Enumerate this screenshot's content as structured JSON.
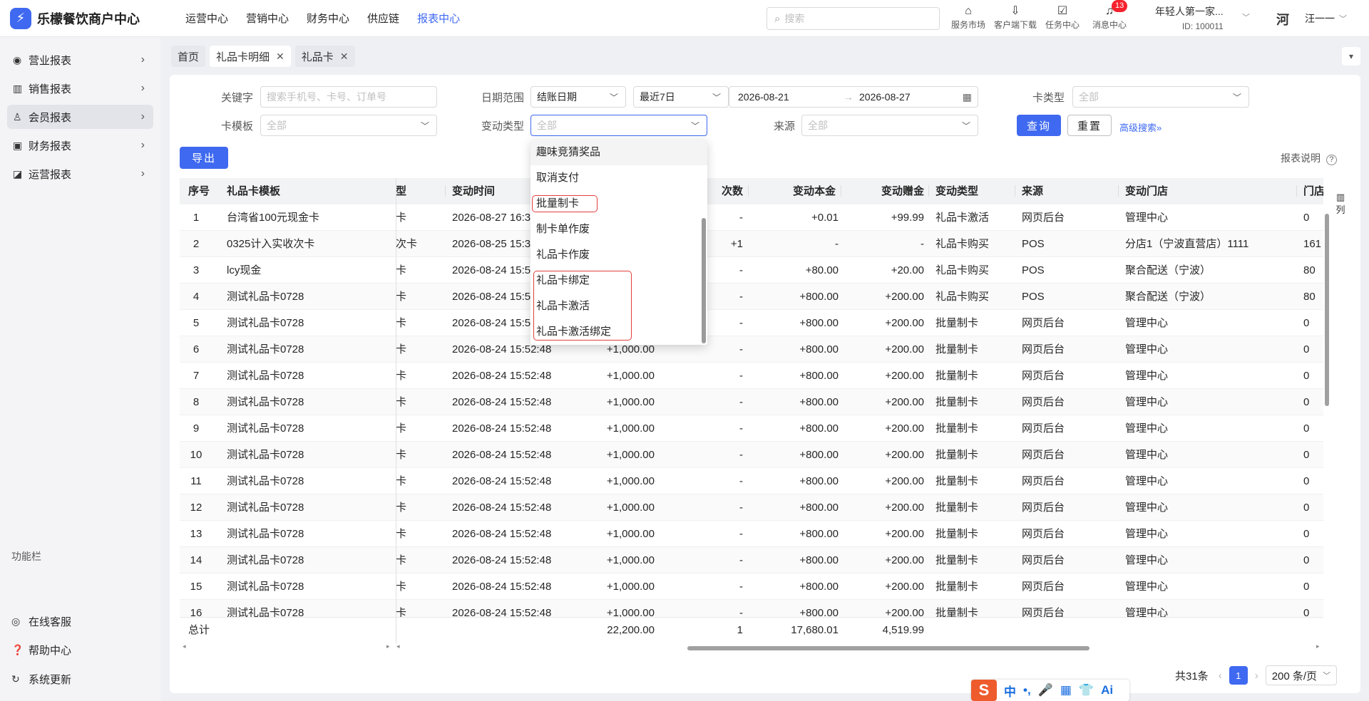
{
  "app": {
    "logo_glyph": "⚡",
    "title": "乐檬餐饮商户中心"
  },
  "topnav": [
    "运营中心",
    "营销中心",
    "财务中心",
    "供应链",
    "报表中心"
  ],
  "search": {
    "placeholder": "搜索"
  },
  "tools": [
    {
      "label": "服务市场",
      "icon": "shop-icon"
    },
    {
      "label": "客户端下载",
      "icon": "download-icon"
    },
    {
      "label": "任务中心",
      "icon": "task-icon"
    },
    {
      "label": "消息中心",
      "icon": "bell-icon",
      "badge": "13"
    }
  ],
  "shop": {
    "name": "年轻人第一家...",
    "id": "ID: 100011"
  },
  "user": {
    "avatar": "河",
    "name": "汪一一"
  },
  "sidebar": {
    "items": [
      {
        "label": "营业报表",
        "icon": "globe-icon"
      },
      {
        "label": "销售报表",
        "icon": "bank-icon"
      },
      {
        "label": "会员报表",
        "icon": "user-icon"
      },
      {
        "label": "财务报表",
        "icon": "finance-icon"
      },
      {
        "label": "运营报表",
        "icon": "bag-icon"
      }
    ],
    "function_title": "功能栏",
    "functions": [
      {
        "label": "在线客服",
        "icon": "service-icon"
      },
      {
        "label": "帮助中心",
        "icon": "help-icon"
      },
      {
        "label": "系统更新",
        "icon": "refresh-icon"
      }
    ]
  },
  "tabs": [
    {
      "label": "首页",
      "closable": false
    },
    {
      "label": "礼品卡明细",
      "closable": true
    },
    {
      "label": "礼品卡",
      "closable": true
    }
  ],
  "filters": {
    "keyword_label": "关键字",
    "keyword_placeholder": "搜索手机号、卡号、订单号",
    "date_label": "日期范围",
    "date_type": "结账日期",
    "date_preset": "最近7日",
    "date_start": "2026-08-21",
    "date_sep": "→",
    "date_end": "2026-08-27",
    "card_type_label": "卡类型",
    "card_type_value": "全部",
    "template_label": "卡模板",
    "template_value": "全部",
    "change_type_label": "变动类型",
    "change_type_value": "全部",
    "source_label": "来源",
    "source_value": "全部",
    "query_btn": "查询",
    "reset_btn": "重置",
    "advanced": "高级搜索»"
  },
  "export_btn": "导出",
  "report_explain": "报表说明",
  "column_settings": "列",
  "dropdown": {
    "options": [
      "趣味竞猜奖品",
      "取消支付",
      "批量制卡",
      "制卡单作废",
      "礼品卡作废",
      "礼品卡绑定",
      "礼品卡激活",
      "礼品卡激活绑定"
    ]
  },
  "table": {
    "columns": [
      "序号",
      "礼品卡模板",
      "型",
      "变动时间",
      "次数",
      "变动本金",
      "变动赠金",
      "变动类型",
      "来源",
      "变动门店",
      "门店编"
    ],
    "rows": [
      [
        "1",
        "台湾省100元现金卡",
        "卡",
        "2026-08-27 16:3",
        "",
        "-",
        "+0.01",
        "+99.99",
        "礼品卡激活",
        "网页后台",
        "管理中心",
        "0"
      ],
      [
        "2",
        "0325计入实收次卡",
        "次卡",
        "2026-08-25 15:3",
        "",
        "+1",
        "-",
        "-",
        "礼品卡购买",
        "POS",
        "分店1（宁波直营店）1111",
        "161"
      ],
      [
        "3",
        "lcy现金",
        "卡",
        "2026-08-24 15:5",
        "",
        "-",
        "+80.00",
        "+20.00",
        "礼品卡购买",
        "POS",
        "聚合配送（宁波）",
        "80"
      ],
      [
        "4",
        "测试礼品卡0728",
        "卡",
        "2026-08-24 15:5",
        "",
        "-",
        "+800.00",
        "+200.00",
        "礼品卡购买",
        "POS",
        "聚合配送（宁波）",
        "80"
      ],
      [
        "5",
        "测试礼品卡0728",
        "卡",
        "2026-08-24 15:5",
        "",
        "-",
        "+800.00",
        "+200.00",
        "批量制卡",
        "网页后台",
        "管理中心",
        "0"
      ],
      [
        "6",
        "测试礼品卡0728",
        "卡",
        "2026-08-24 15:52:48",
        "+1,000.00",
        "-",
        "+800.00",
        "+200.00",
        "批量制卡",
        "网页后台",
        "管理中心",
        "0"
      ],
      [
        "7",
        "测试礼品卡0728",
        "卡",
        "2026-08-24 15:52:48",
        "+1,000.00",
        "-",
        "+800.00",
        "+200.00",
        "批量制卡",
        "网页后台",
        "管理中心",
        "0"
      ],
      [
        "8",
        "测试礼品卡0728",
        "卡",
        "2026-08-24 15:52:48",
        "+1,000.00",
        "-",
        "+800.00",
        "+200.00",
        "批量制卡",
        "网页后台",
        "管理中心",
        "0"
      ],
      [
        "9",
        "测试礼品卡0728",
        "卡",
        "2026-08-24 15:52:48",
        "+1,000.00",
        "-",
        "+800.00",
        "+200.00",
        "批量制卡",
        "网页后台",
        "管理中心",
        "0"
      ],
      [
        "10",
        "测试礼品卡0728",
        "卡",
        "2026-08-24 15:52:48",
        "+1,000.00",
        "-",
        "+800.00",
        "+200.00",
        "批量制卡",
        "网页后台",
        "管理中心",
        "0"
      ],
      [
        "11",
        "测试礼品卡0728",
        "卡",
        "2026-08-24 15:52:48",
        "+1,000.00",
        "-",
        "+800.00",
        "+200.00",
        "批量制卡",
        "网页后台",
        "管理中心",
        "0"
      ],
      [
        "12",
        "测试礼品卡0728",
        "卡",
        "2026-08-24 15:52:48",
        "+1,000.00",
        "-",
        "+800.00",
        "+200.00",
        "批量制卡",
        "网页后台",
        "管理中心",
        "0"
      ],
      [
        "13",
        "测试礼品卡0728",
        "卡",
        "2026-08-24 15:52:48",
        "+1,000.00",
        "-",
        "+800.00",
        "+200.00",
        "批量制卡",
        "网页后台",
        "管理中心",
        "0"
      ],
      [
        "14",
        "测试礼品卡0728",
        "卡",
        "2026-08-24 15:52:48",
        "+1,000.00",
        "-",
        "+800.00",
        "+200.00",
        "批量制卡",
        "网页后台",
        "管理中心",
        "0"
      ],
      [
        "15",
        "测试礼品卡0728",
        "卡",
        "2026-08-24 15:52:48",
        "+1,000.00",
        "-",
        "+800.00",
        "+200.00",
        "批量制卡",
        "网页后台",
        "管理中心",
        "0"
      ],
      [
        "16",
        "测试礼品卡0728",
        "卡",
        "2026-08-24 15:52:48",
        "+1,000.00",
        "-",
        "+800.00",
        "+200.00",
        "批量制卡",
        "网页后台",
        "管理中心",
        "0"
      ]
    ],
    "total": {
      "label": "总计",
      "amount": "22,200.00",
      "times": "1",
      "principal": "17,680.01",
      "bonus": "4,519.99"
    }
  },
  "pagination": {
    "total": "共31条",
    "current": "1",
    "page_size": "200 条/页"
  },
  "ime": {
    "logo": "S",
    "items": [
      "中",
      "•,",
      "🎤",
      "▦",
      "👕",
      "Ai"
    ]
  },
  "colors": {
    "primary": "#3f69f0",
    "highlight_ring": "#e0403b",
    "badge": "#f5222d"
  }
}
